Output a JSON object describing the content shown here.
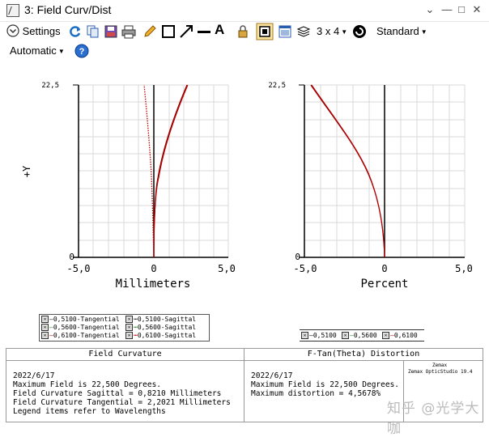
{
  "window": {
    "title": "3: Field Curv/Dist",
    "min_glyph": "—",
    "max_glyph": "□",
    "close_glyph": "✕",
    "pin_glyph": "⌄"
  },
  "toolbar": {
    "settings_label": "Settings",
    "grid_label": "3 x 4",
    "standard_label": "Standard",
    "automatic_label": "Automatic",
    "text_tool_glyph": "A"
  },
  "plots": {
    "field_curvature": {
      "ytick_top": "22,5",
      "ytick_bottom": "0",
      "ylabel": "+Y",
      "xticks": [
        "-5,0",
        "0",
        "5,0"
      ],
      "xlabel": "Millimeters"
    },
    "distortion": {
      "ytick_top": "22,5",
      "ytick_bottom": "0",
      "xticks": [
        "-5,0",
        "0",
        "5,0"
      ],
      "xlabel": "Percent"
    }
  },
  "legend_left": {
    "items": [
      [
        "0,5100-Tangential",
        "0,5100-Sagittal"
      ],
      [
        "0,5600-Tangential",
        "0,5600-Sagittal"
      ],
      [
        "0,6100-Tangential",
        "0,6100-Sagittal"
      ]
    ]
  },
  "legend_right": {
    "items": [
      "0,5100",
      "0,5600",
      "0,6100"
    ]
  },
  "info": {
    "fc_heading": "Field Curvature",
    "dist_heading": "F-Tan(Theta) Distortion",
    "fc_date": "2022/6/17",
    "fc_line1": "Maximum Field is 22,500 Degrees.",
    "fc_line2": "Field Curvature Sagittal = 0,8210 Millimeters",
    "fc_line3": "Field Curvature Tangential = 2,2021 Millimeters",
    "fc_line4": "Legend items refer to Wavelengths",
    "dist_date": "2022/6/17",
    "dist_line1": "Maximum Field is 22,500 Degrees.",
    "dist_line2": "Maximum distortion = 4,5678%",
    "brand1": "Zemax",
    "brand2": "Zemax OpticStudio 19.4"
  },
  "watermark": "知乎 @光学大咖",
  "colors": {
    "curve_red": "#c00000",
    "curve_darkred": "#8b0000",
    "grid": "#d8d8d8",
    "accent": "#1a6fc4"
  }
}
